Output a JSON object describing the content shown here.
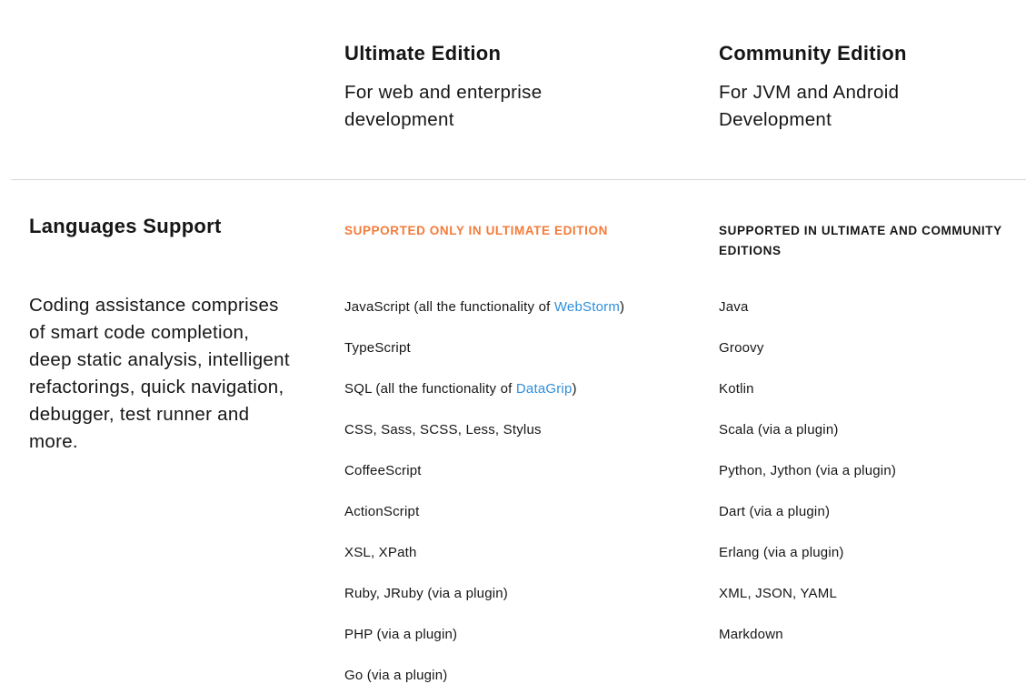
{
  "editions": {
    "ultimate": {
      "title": "Ultimate Edition",
      "subtitle_line1": "For web and enterprise",
      "subtitle_line2": "development"
    },
    "community": {
      "title": "Community Edition",
      "subtitle_line1": "For JVM and Android",
      "subtitle_line2": "Development"
    }
  },
  "section": {
    "title": "Languages Support",
    "description": "Coding assistance comprises of smart code completion, deep static analysis, intelligent refactorings, quick navigation, debugger, test runner and more."
  },
  "ultimate_column": {
    "label": "SUPPORTED ONLY IN ULTIMATE EDITION",
    "label_color": "#f47b3a",
    "items": [
      {
        "prefix": "JavaScript (all the functionality of ",
        "link": "WebStorm",
        "suffix": ")"
      },
      {
        "prefix": "TypeScript",
        "link": "",
        "suffix": ""
      },
      {
        "prefix": "SQL (all the functionality of ",
        "link": "DataGrip",
        "suffix": ")"
      },
      {
        "prefix": "CSS, Sass, SCSS, Less, Stylus",
        "link": "",
        "suffix": ""
      },
      {
        "prefix": "CoffeeScript",
        "link": "",
        "suffix": ""
      },
      {
        "prefix": "ActionScript",
        "link": "",
        "suffix": ""
      },
      {
        "prefix": "XSL, XPath",
        "link": "",
        "suffix": ""
      },
      {
        "prefix": "Ruby, JRuby (via a plugin)",
        "link": "",
        "suffix": ""
      },
      {
        "prefix": "PHP (via a plugin)",
        "link": "",
        "suffix": ""
      },
      {
        "prefix": "Go (via a plugin)",
        "link": "",
        "suffix": ""
      }
    ]
  },
  "community_column": {
    "label_line1": "SUPPORTED IN ULTIMATE AND COMMUNITY",
    "label_line2": "EDITIONS",
    "items": [
      "Java",
      "Groovy",
      "Kotlin",
      "Scala (via a plugin)",
      "Python, Jython (via a plugin)",
      "Dart (via a plugin)",
      "Erlang (via a plugin)",
      "XML, JSON, YAML",
      "Markdown"
    ]
  },
  "colors": {
    "link": "#2f8fde",
    "accent": "#f47b3a",
    "divider": "#d8d8d8"
  }
}
